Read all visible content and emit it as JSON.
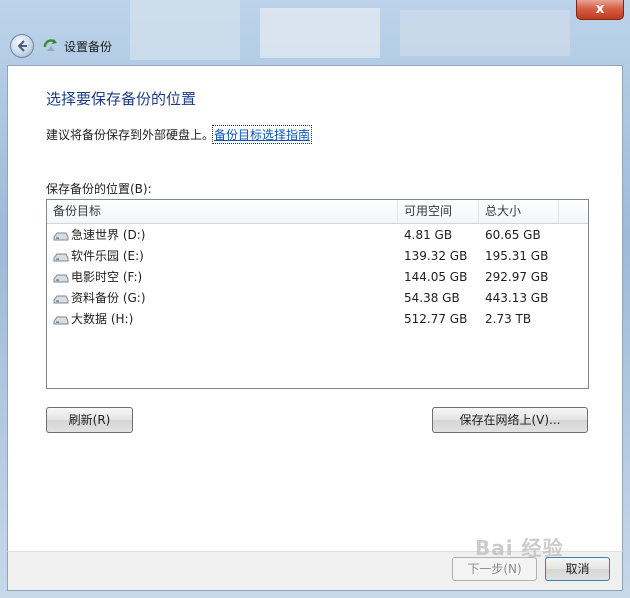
{
  "window": {
    "title": "设置备份",
    "close_label": "x"
  },
  "main": {
    "heading": "选择要保存备份的位置",
    "advice": "建议将备份保存到外部硬盘上。",
    "guide_link": "备份目标选择指南",
    "location_label": "保存备份的位置(B):"
  },
  "table": {
    "columns": [
      "备份目标",
      "可用空间",
      "总大小"
    ],
    "rows": [
      {
        "name": "急速世界 (D:)",
        "free": "4.81 GB",
        "size": "60.65 GB"
      },
      {
        "name": "软件乐园 (E:)",
        "free": "139.32 GB",
        "size": "195.31 GB"
      },
      {
        "name": "电影时空 (F:)",
        "free": "144.05 GB",
        "size": "292.97 GB"
      },
      {
        "name": "资料备份 (G:)",
        "free": "54.38 GB",
        "size": "443.13 GB"
      },
      {
        "name": "大数据 (H:)",
        "free": "512.77 GB",
        "size": "2.73 TB"
      }
    ]
  },
  "buttons": {
    "refresh": "刷新(R)",
    "network": "保存在网络上(V)...",
    "next": "下一步(N)",
    "cancel": "取消"
  },
  "watermark": "Bai 经验",
  "colors": {
    "heading": "#1e3e8a",
    "link": "#0a55b3"
  }
}
